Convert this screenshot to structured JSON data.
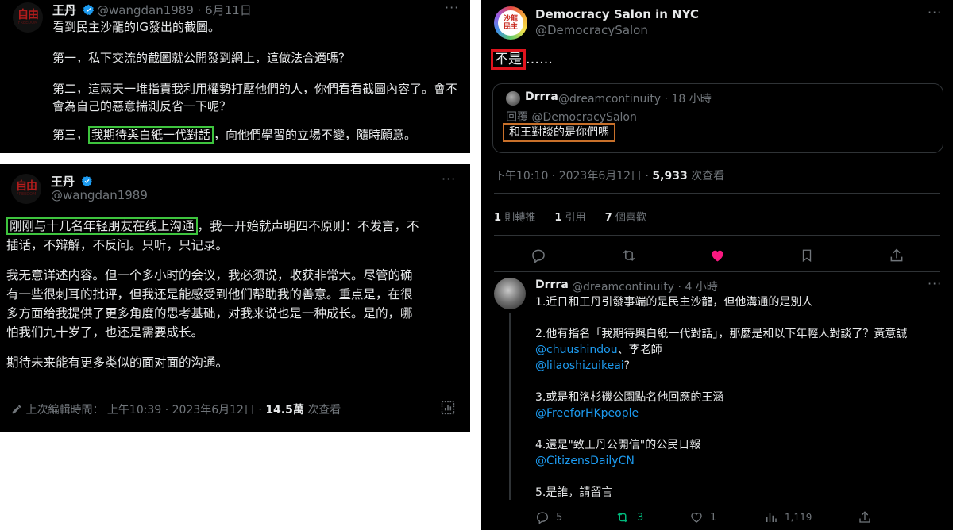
{
  "tweet1": {
    "name": "王丹",
    "handle_date": "@wangdan1989 · 6月11日",
    "lines": [
      "看到民主沙龍的IG發出的截圖。",
      "第一，私下交流的截圖就公開發到網上，這做法合適嗎？",
      "第二，這兩天一堆指責我利用權勢打壓他們的人，你們看看截圖內容了。會不",
      "會為自己的惡意揣測反省一下呢？"
    ],
    "line4_prefix": "第三，",
    "line4_highlight": "我期待與白紙一代對話",
    "line4_suffix": "，向他們學習的立場不變，隨時願意。"
  },
  "tweet2": {
    "name": "王丹",
    "handle": "@wangdan1989",
    "highlight": "刚刚与十几名年轻朋友在线上沟通",
    "line1_suffix": "，我一开始就声明四不原则：不发言，不",
    "line2": "插话，不辩解，不反问。只听，只记录。",
    "para2": [
      "我无意详述内容。但一个多小时的会议，我必须说，收获非常大。尽管的确",
      "有一些很刺耳的批评，但我还是能感受到他们帮助我的善意。重点是，在很",
      "多方面给我提供了更多角度的思考基础，对我来说也是一种成长。是的，哪",
      "怕我们九十岁了，也还是需要成长。"
    ],
    "para3": "期待未来能有更多类似的面对面的沟通。",
    "edited": "上次編輯時間：",
    "time": "上午10:39 · 2023年6月12日 · ",
    "views": "14.5萬",
    "views_label": " 次查看"
  },
  "tweet3": {
    "name": "Democracy Salon in NYC",
    "handle": "@DemocracySalon",
    "avatar_text": "沙龍\n民主",
    "body_boxed": "不是",
    "body_rest": "……",
    "quote": {
      "name": "Drrra",
      "handle_time": "@dreamcontinuity · 18 小時",
      "reply_to": "回覆 @DemocracySalon",
      "text": "和王對談的是你們嗎"
    },
    "time": "下午10:10 · 2023年6月12日 · ",
    "views": "5,933",
    "views_label": " 次查看",
    "stats": [
      {
        "count": "1",
        "label": "則轉推"
      },
      {
        "count": "1",
        "label": "引用"
      },
      {
        "count": "7",
        "label": "個喜歡"
      }
    ]
  },
  "reply": {
    "name": "Drrra",
    "handle_time": "@dreamcontinuity · 4 小時",
    "p1": "1.近日和王丹引發事端的是民主沙龍，但他溝通的是別人",
    "p2": "2.他有指名「我期待與白紙一代對話」，那麼是和以下年輕人對談了？黃意誠",
    "p2_links": "@chuushindou",
    "p2_sep": "、李老師",
    "p2_link2": "@lilaoshizuikeai",
    "p2_q": "?",
    "p3": "3.或是和洛杉磯公園點名他回應的王涵",
    "p3_link": "@FreeforHKpeople",
    "p4": "4.還是\"致王丹公開信\"的公民日報",
    "p4_link": "@CitizensDailyCN",
    "p5": "5.是誰，請留言",
    "actions": {
      "replies": "5",
      "retweets": "3",
      "likes": "1",
      "views": "1,119"
    }
  },
  "colors": {
    "green_box": "#3ec43e",
    "red_box": "#e0141e",
    "orange_box": "#c8702a",
    "link": "#1d9bf0",
    "like": "#f91880",
    "retweet": "#00ba7c"
  }
}
